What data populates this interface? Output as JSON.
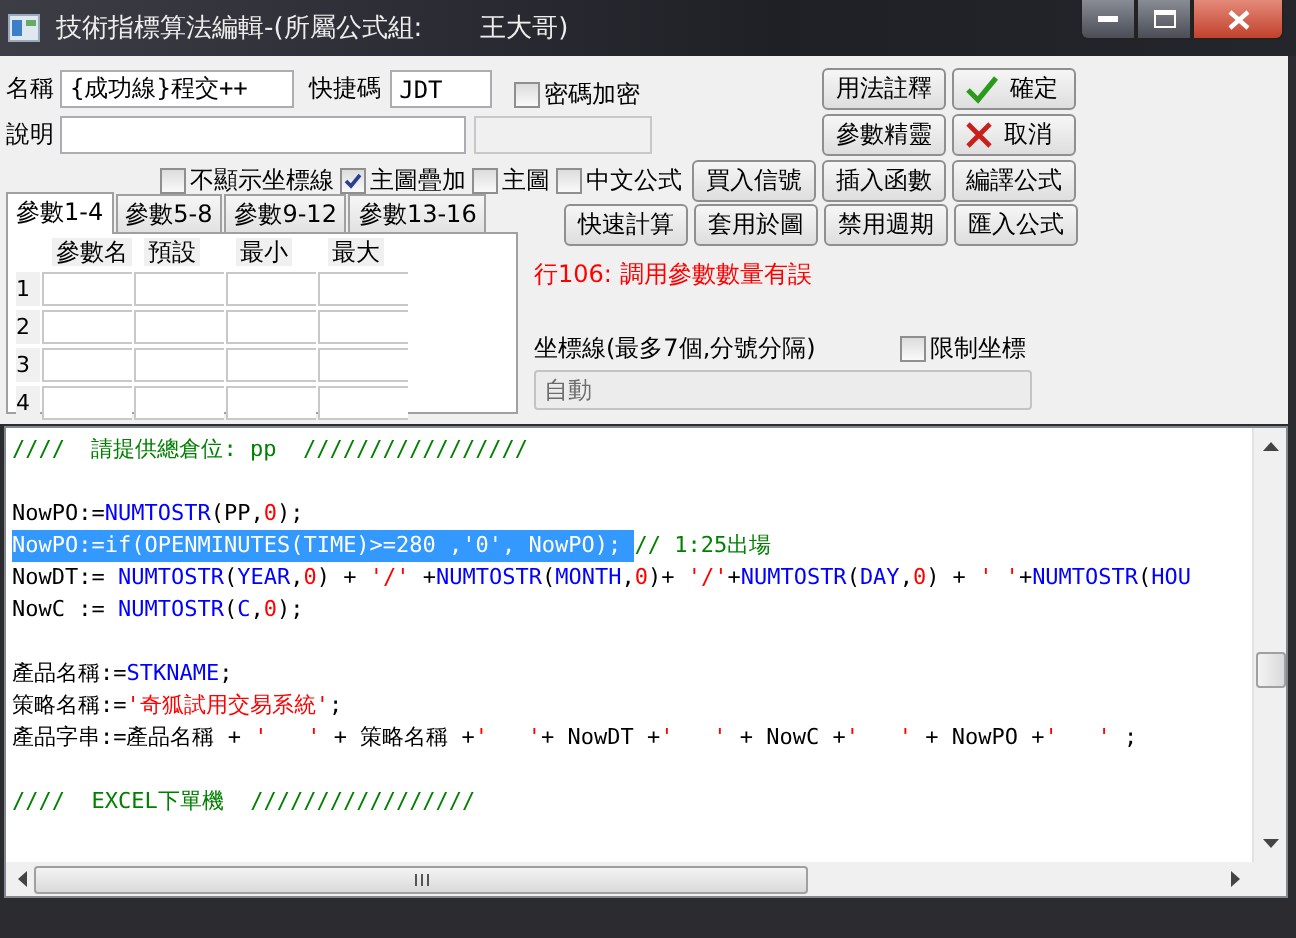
{
  "window": {
    "title": "技術指標算法編輯-(所屬公式組:       王大哥)"
  },
  "form": {
    "name": {
      "label": "名稱",
      "value": "{成功線}程交++"
    },
    "shortcut": {
      "label": "快捷碼",
      "value": "JDT"
    },
    "password": {
      "label": "密碼加密",
      "checked": false
    },
    "description": {
      "label": "說明"
    },
    "options": [
      {
        "label": "不顯示坐標線",
        "checked": false
      },
      {
        "label": "主圖疊加",
        "checked": true
      },
      {
        "label": "主圖",
        "checked": false
      },
      {
        "label": "中文公式",
        "checked": false
      }
    ],
    "button_rows": [
      [
        {
          "label": "用法註釋",
          "kind": "plain"
        },
        {
          "label": "確定",
          "kind": "ok"
        }
      ],
      [
        {
          "label": "參數精靈",
          "kind": "plain"
        },
        {
          "label": "取消",
          "kind": "cancel"
        }
      ],
      [
        {
          "label": "買入信號",
          "kind": "plain"
        },
        {
          "label": "插入函數",
          "kind": "plain"
        },
        {
          "label": "編譯公式",
          "kind": "plain"
        }
      ],
      [
        {
          "label": "快速計算",
          "kind": "plain"
        },
        {
          "label": "套用於圖",
          "kind": "plain"
        },
        {
          "label": "禁用週期",
          "kind": "plain"
        },
        {
          "label": "匯入公式",
          "kind": "plain"
        }
      ]
    ],
    "param_tabs": [
      {
        "label": "參數1-4",
        "selected": true
      },
      {
        "label": "參數5-8",
        "selected": false
      },
      {
        "label": "參數9-12",
        "selected": false
      },
      {
        "label": "參數13-16",
        "selected": false
      }
    ],
    "param_table": {
      "columns": [
        "參數名",
        "預設",
        "最小",
        "最大"
      ],
      "rows": [
        "1",
        "2",
        "3",
        "4"
      ]
    },
    "error_message": "行106: 調用參數數量有誤",
    "axis_lines": {
      "label": "坐標線(最多7個,分號分隔)",
      "placeholder": "自動",
      "limit": {
        "label": "限制坐標",
        "checked": false
      }
    }
  },
  "editor": {
    "lines": [
      {
        "kind": "code",
        "tokens": [
          {
            "kind": "comment",
            "text": "////  請提供總倉位: pp  /////////////////"
          }
        ]
      },
      {
        "kind": "blank"
      },
      {
        "kind": "code",
        "tokens": [
          {
            "kind": "plain",
            "text": "NowPO:="
          },
          {
            "kind": "func",
            "text": "NUMTOSTR"
          },
          {
            "kind": "plain",
            "text": "(PP,"
          },
          {
            "kind": "num",
            "text": "0"
          },
          {
            "kind": "plain",
            "text": ");"
          }
        ]
      },
      {
        "kind": "code",
        "tokens": [
          {
            "kind": "selection",
            "text": "NowPO:=if(OPENMINUTES(TIME)>=280 ,'0', NowPO); "
          },
          {
            "kind": "comment",
            "text": "// 1:25出場"
          }
        ]
      },
      {
        "kind": "code",
        "tokens": [
          {
            "kind": "plain",
            "text": "NowDT:= "
          },
          {
            "kind": "func",
            "text": "NUMTOSTR"
          },
          {
            "kind": "plain",
            "text": "("
          },
          {
            "kind": "func",
            "text": "YEAR"
          },
          {
            "kind": "plain",
            "text": ","
          },
          {
            "kind": "num",
            "text": "0"
          },
          {
            "kind": "plain",
            "text": ") + "
          },
          {
            "kind": "str",
            "text": "'/'"
          },
          {
            "kind": "plain",
            "text": " +"
          },
          {
            "kind": "func",
            "text": "NUMTOSTR"
          },
          {
            "kind": "plain",
            "text": "("
          },
          {
            "kind": "func",
            "text": "MONTH"
          },
          {
            "kind": "plain",
            "text": ","
          },
          {
            "kind": "num",
            "text": "0"
          },
          {
            "kind": "plain",
            "text": ")+ "
          },
          {
            "kind": "str",
            "text": "'/'"
          },
          {
            "kind": "plain",
            "text": "+"
          },
          {
            "kind": "func",
            "text": "NUMTOSTR"
          },
          {
            "kind": "plain",
            "text": "("
          },
          {
            "kind": "func",
            "text": "DAY"
          },
          {
            "kind": "plain",
            "text": ","
          },
          {
            "kind": "num",
            "text": "0"
          },
          {
            "kind": "plain",
            "text": ") + "
          },
          {
            "kind": "str",
            "text": "' '"
          },
          {
            "kind": "plain",
            "text": "+"
          },
          {
            "kind": "func",
            "text": "NUMTOSTR"
          },
          {
            "kind": "plain",
            "text": "("
          },
          {
            "kind": "func",
            "text": "HOU"
          }
        ]
      },
      {
        "kind": "code",
        "tokens": [
          {
            "kind": "plain",
            "text": "NowC := "
          },
          {
            "kind": "func",
            "text": "NUMTOSTR"
          },
          {
            "kind": "plain",
            "text": "("
          },
          {
            "kind": "func",
            "text": "C"
          },
          {
            "kind": "plain",
            "text": ","
          },
          {
            "kind": "num",
            "text": "0"
          },
          {
            "kind": "plain",
            "text": ");"
          }
        ]
      },
      {
        "kind": "blank"
      },
      {
        "kind": "code",
        "tokens": [
          {
            "kind": "plain",
            "text": "產品名稱:="
          },
          {
            "kind": "func",
            "text": "STKNAME"
          },
          {
            "kind": "plain",
            "text": ";"
          }
        ]
      },
      {
        "kind": "code",
        "tokens": [
          {
            "kind": "plain",
            "text": "策略名稱:="
          },
          {
            "kind": "str",
            "text": "'奇狐試用交易系統'"
          },
          {
            "kind": "plain",
            "text": ";"
          }
        ]
      },
      {
        "kind": "code",
        "tokens": [
          {
            "kind": "plain",
            "text": "產品字串:=產品名稱 + "
          },
          {
            "kind": "str",
            "text": "'   '"
          },
          {
            "kind": "plain",
            "text": " + 策略名稱 +"
          },
          {
            "kind": "str",
            "text": "'   '"
          },
          {
            "kind": "plain",
            "text": "+ NowDT +"
          },
          {
            "kind": "str",
            "text": "'   '"
          },
          {
            "kind": "plain",
            "text": " + NowC +"
          },
          {
            "kind": "str",
            "text": "'   '"
          },
          {
            "kind": "plain",
            "text": " + NowPO +"
          },
          {
            "kind": "str",
            "text": "'   '"
          },
          {
            "kind": "plain",
            "text": " ;"
          }
        ]
      },
      {
        "kind": "blank"
      },
      {
        "kind": "code",
        "tokens": [
          {
            "kind": "comment",
            "text": "////  EXCEL下單機  /////////////////"
          }
        ]
      }
    ]
  }
}
